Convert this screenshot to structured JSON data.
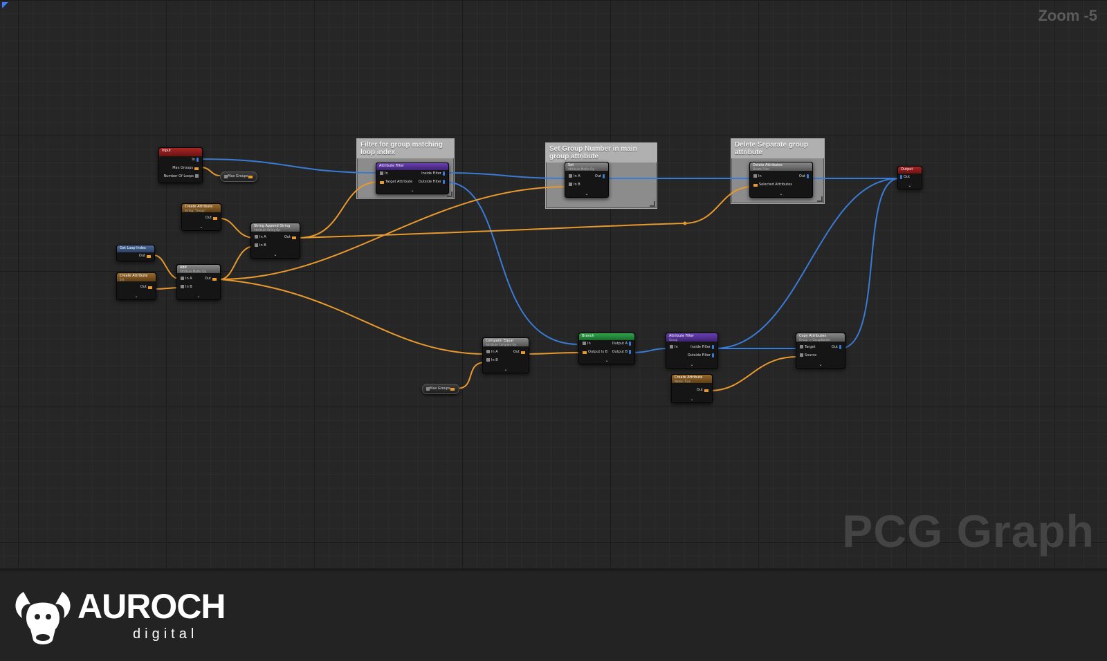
{
  "zoom_label": "Zoom -5",
  "watermark": "PCG Graph",
  "comments": {
    "filter": "Filter for group matching loop index",
    "setgroup": "Set Group Number in main group attribute",
    "delete": "Delete Separate group attribute"
  },
  "nodes": {
    "input": {
      "title": "Input",
      "pins": {
        "in": "In",
        "max_groups": "Max Groups",
        "loops": "Number Of Loops"
      }
    },
    "max_groups_pill_top": {
      "label": "Max Groups"
    },
    "create_attr_1": {
      "title": "Create Attribute",
      "subtitle": "String: \"Group\"",
      "out": "Out"
    },
    "set_loop_index": {
      "title": "Get Loop Index",
      "out": "Out"
    },
    "create_attr_2": {
      "title": "Create Attribute",
      "subtitle": "0.0",
      "out": "Out"
    },
    "add": {
      "title": "Add",
      "subtitle": "Attribute Maths Op",
      "in_a": "In A",
      "in_b": "In B",
      "out": "Out"
    },
    "string_append": {
      "title": "String Append String",
      "subtitle": "Attribute String Op",
      "in_a": "In A",
      "in_b": "In B",
      "out": "Out"
    },
    "attribute_filter_1": {
      "title": "Attribute Filter",
      "in": "In",
      "target": "Target Attribute",
      "inside": "Inside Filter",
      "outside": "Outside Filter"
    },
    "set_node": {
      "title": "Set",
      "subtitle": "Attribute Maths Op",
      "in_a": "In A",
      "in_b": "In B",
      "out": "Out"
    },
    "delete_attributes": {
      "title": "Delete Attributes",
      "subtitle": "Delete Filter",
      "in": "In",
      "selected": "Selected Attributes",
      "out": "Out"
    },
    "output": {
      "title": "Output",
      "out": "Out"
    },
    "compare_equal": {
      "title": "Compare: Equal",
      "subtitle": "Attribute Compare Op",
      "in_a": "In A",
      "in_b": "In B",
      "out": "Out"
    },
    "max_groups_pill_bottom": {
      "label": "Max Groups"
    },
    "branch": {
      "title": "Branch",
      "in": "In",
      "output_is_b": "Output Is B",
      "out_a": "Output A",
      "out_b": "Output B"
    },
    "attribute_filter_2": {
      "title": "Attribute Filter",
      "subtitle": "Group",
      "in": "In",
      "inside": "Inside Filter",
      "outside": "Outside Filter"
    },
    "create_attr_3": {
      "title": "Create Attribute",
      "subtitle": "Name: True",
      "out": "Out"
    },
    "copy_attributes": {
      "title": "Copy Attributes",
      "subtitle": "Group -> GroupNumbr",
      "target": "Target",
      "source": "Source",
      "out": "Out"
    }
  },
  "footer": {
    "brand": "AUROCH",
    "brand_sub": "digital",
    "logo_icon": "bull-head-icon"
  },
  "colors": {
    "exec_wire": "#3a7bd5",
    "attr_wire": "#e89a2e",
    "accent": "#3d7cff"
  }
}
